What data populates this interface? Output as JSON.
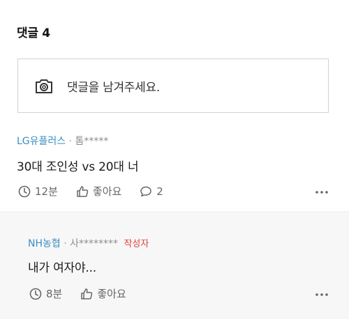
{
  "section": {
    "title": "댓글 4"
  },
  "input": {
    "placeholder": "댓글을 남겨주세요."
  },
  "comments": [
    {
      "author": "LG유플러스",
      "separator": "·",
      "masked_user": "톰*****",
      "body": "30대 조인성 vs 20대 너",
      "time": "12분",
      "like_label": "좋아요",
      "reply_count": "2",
      "is_writer": false
    },
    {
      "author": "NH농협",
      "separator": "·",
      "masked_user": "사********",
      "writer_badge": "작성자",
      "body": "내가 여자야...",
      "time": "8분",
      "like_label": "좋아요",
      "is_writer": true
    }
  ],
  "colors": {
    "author": "#3a8fc0",
    "writer_badge": "#e0433b",
    "reply_background": "#f7f7f7",
    "icon": "#666666"
  },
  "icons": {
    "camera": "camera-icon",
    "clock": "clock-icon",
    "thumbs_up": "thumbs-up-icon",
    "speech_bubble": "comment-bubble-icon",
    "more": "more-dots-icon"
  }
}
